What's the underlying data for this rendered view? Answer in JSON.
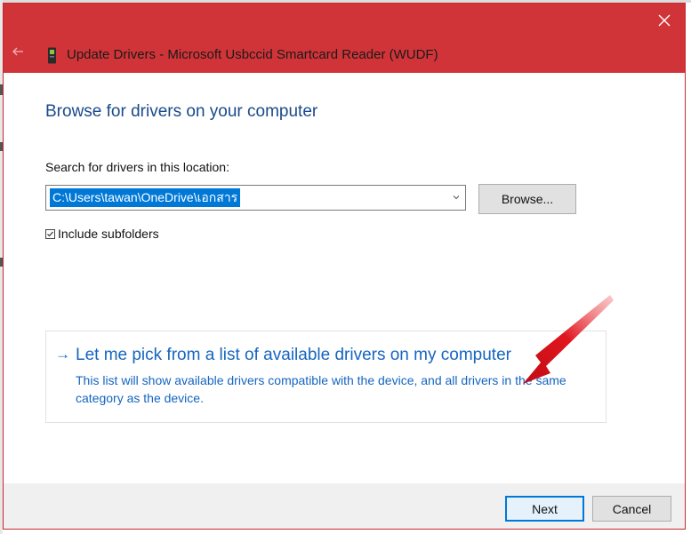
{
  "window": {
    "title": "Update Drivers - Microsoft Usbccid Smartcard Reader (WUDF)",
    "accent_color": "#d13438",
    "icons": {
      "back": "back-arrow-icon",
      "close": "close-icon",
      "device": "smartcard-device-icon"
    }
  },
  "main": {
    "heading": "Browse for drivers on your computer",
    "search_label": "Search for drivers in this location:",
    "path_value": "C:\\Users\\tawan\\OneDrive\\เอกสาร",
    "browse_label": "Browse...",
    "include_subfolders": {
      "label": "Include subfolders",
      "checked": true
    }
  },
  "pick": {
    "arrow_glyph": "→",
    "title": "Let me pick from a list of available drivers on my computer",
    "description": "This list will show available drivers compatible with the device, and all drivers in the same category as the device.",
    "link_color": "#1565c0"
  },
  "annotation": {
    "icon": "red-pointer-arrow-icon",
    "color": "#e0161e"
  },
  "footer": {
    "next_label": "Next",
    "cancel_label": "Cancel"
  }
}
